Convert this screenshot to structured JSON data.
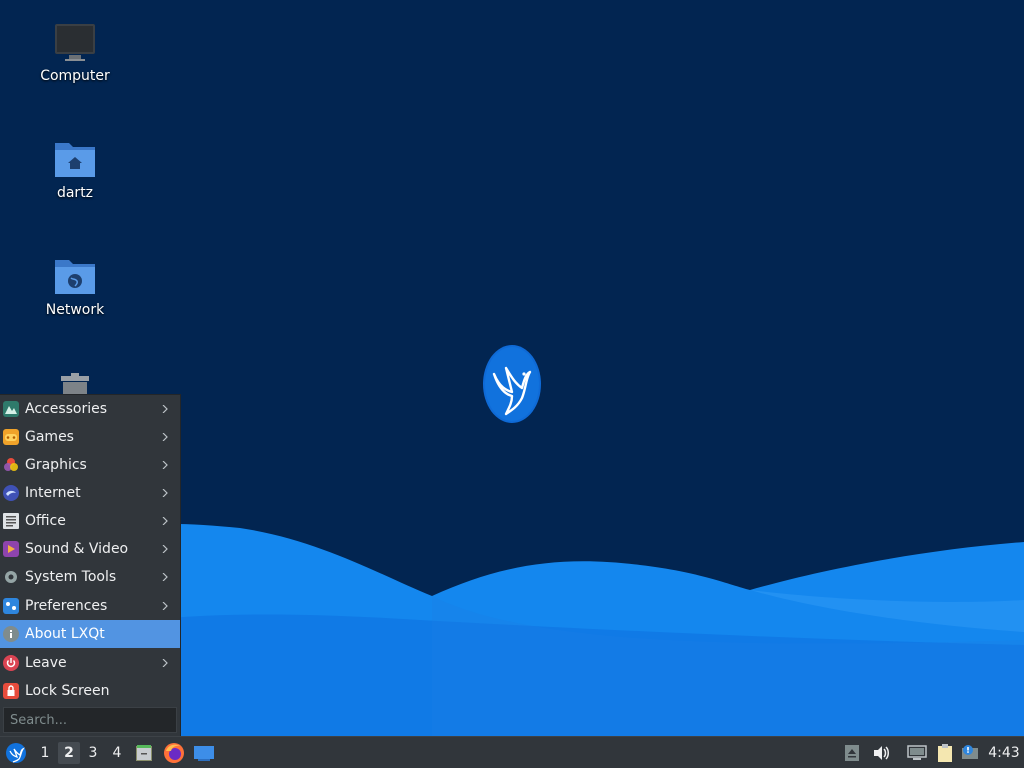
{
  "desktop": {
    "icons": [
      {
        "label": "Computer",
        "icon": "computer-icon"
      },
      {
        "label": "dartz",
        "icon": "home-folder-icon"
      },
      {
        "label": "Network",
        "icon": "network-folder-icon"
      },
      {
        "label": "",
        "icon": "trash-icon"
      }
    ],
    "logo": "lxqt-bird-logo"
  },
  "start_menu": {
    "items": [
      {
        "label": "Accessories",
        "icon": "accessories-icon",
        "submenu": true
      },
      {
        "label": "Games",
        "icon": "games-icon",
        "submenu": true
      },
      {
        "label": "Graphics",
        "icon": "graphics-icon",
        "submenu": true
      },
      {
        "label": "Internet",
        "icon": "internet-icon",
        "submenu": true
      },
      {
        "label": "Office",
        "icon": "office-icon",
        "submenu": true
      },
      {
        "label": "Sound & Video",
        "icon": "sound-video-icon",
        "submenu": true
      },
      {
        "label": "System Tools",
        "icon": "system-tools-icon",
        "submenu": true
      },
      {
        "label": "Preferences",
        "icon": "preferences-icon",
        "submenu": true
      },
      {
        "label": "About LXQt",
        "icon": "info-icon",
        "submenu": false,
        "highlighted": true
      },
      {
        "label": "Leave",
        "icon": "power-icon",
        "submenu": true
      },
      {
        "label": "Lock Screen",
        "icon": "lock-icon",
        "submenu": false
      }
    ],
    "search_placeholder": "Search..."
  },
  "taskbar": {
    "desktops": [
      "1",
      "2",
      "3",
      "4"
    ],
    "active_desktop": "2",
    "launchers": [
      "file-manager-icon",
      "firefox-icon",
      "show-desktop-icon"
    ],
    "tray": [
      "eject-icon",
      "volume-icon",
      "network-tray-icon",
      "clipboard-icon",
      "update-notifier-icon"
    ],
    "clock": "4:43"
  },
  "colors": {
    "desktop_bg": "#022551",
    "wave_light": "#1a8cf0",
    "wave_dark": "#0a64d6",
    "panel_bg": "#31363b",
    "highlight": "#5294e2"
  }
}
